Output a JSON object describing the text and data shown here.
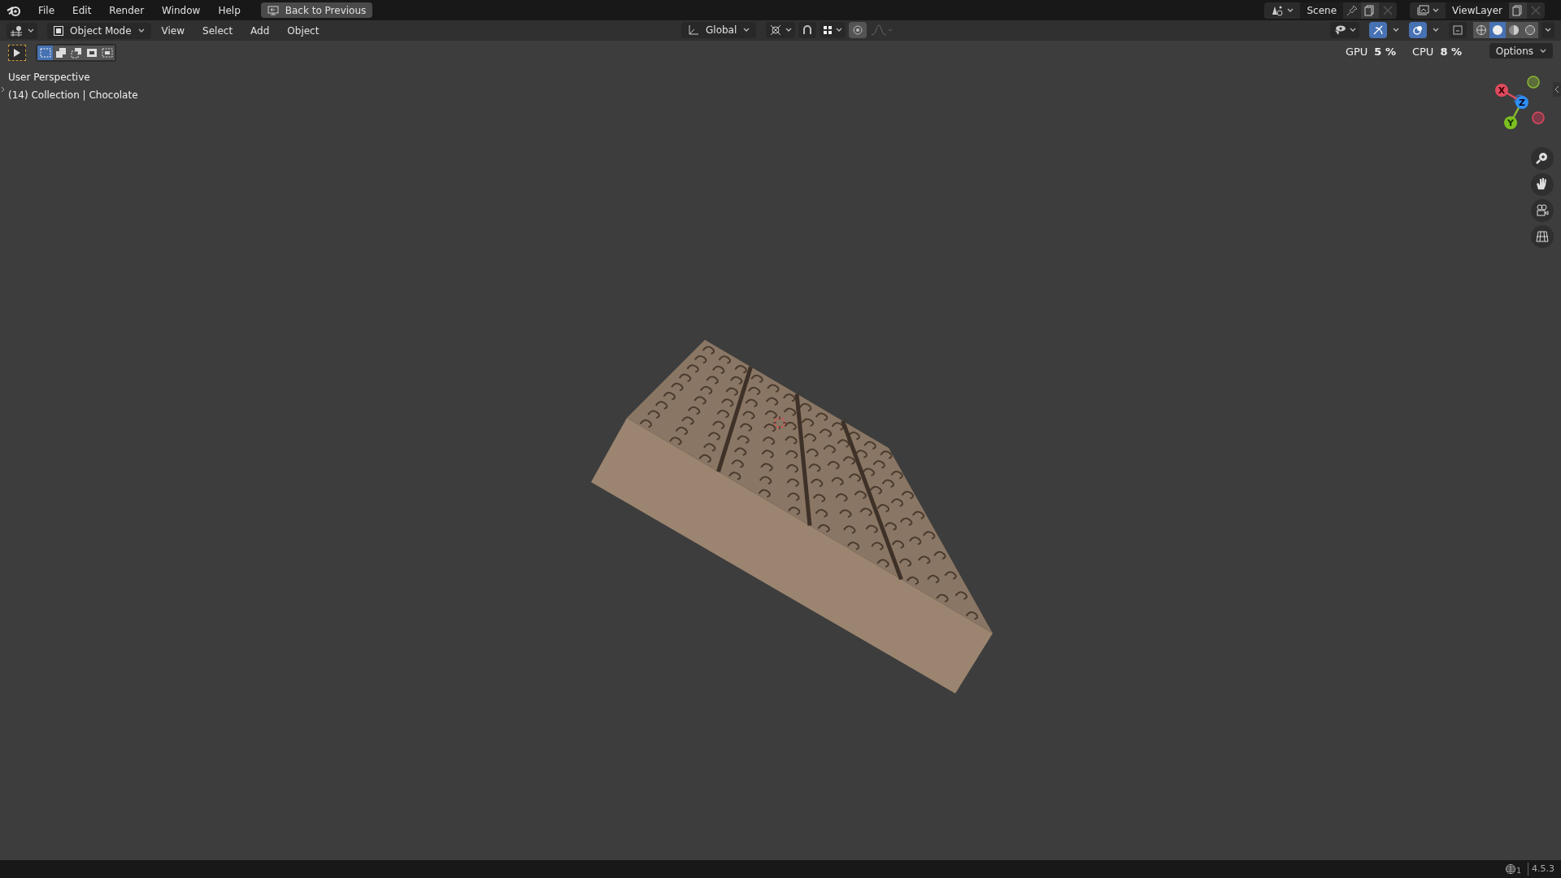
{
  "menu_bar": {
    "items": [
      "File",
      "Edit",
      "Render",
      "Window",
      "Help"
    ],
    "back_button": "Back to Previous",
    "scene": "Scene",
    "view_layer": "ViewLayer"
  },
  "header": {
    "mode": "Object Mode",
    "menus": [
      "View",
      "Select",
      "Add",
      "Object"
    ],
    "orientation": "Global",
    "options": "Options",
    "toggles": [
      {
        "kind": "snap",
        "on": false
      },
      {
        "kind": "proportional",
        "on": true
      },
      {
        "kind": "gizmos",
        "on": true
      },
      {
        "kind": "overlays",
        "on": true
      },
      {
        "kind": "xray",
        "on": false
      }
    ],
    "shading_modes": [
      {
        "kind": "wireframe",
        "selected": false
      },
      {
        "kind": "solid",
        "selected": true
      },
      {
        "kind": "material",
        "selected": false
      },
      {
        "kind": "rendered",
        "selected": false
      }
    ]
  },
  "stats_overlay": [
    {
      "label": "GPU",
      "value": "5 %"
    },
    {
      "label": "CPU",
      "value": "8 %"
    }
  ],
  "toolbar": {
    "select_modes": [
      {
        "kind": "new",
        "selected": true
      },
      {
        "kind": "extend",
        "selected": false
      },
      {
        "kind": "subtract",
        "selected": false
      },
      {
        "kind": "invert",
        "selected": false
      },
      {
        "kind": "intersect",
        "selected": false
      }
    ]
  },
  "viewport": {
    "view_name": "User Perspective",
    "collection": "(14) Collection | Chocolate",
    "axes": [
      "X",
      "Y",
      "Z"
    ]
  },
  "status_bar": {
    "version": "4.5.3",
    "badge": "1"
  }
}
